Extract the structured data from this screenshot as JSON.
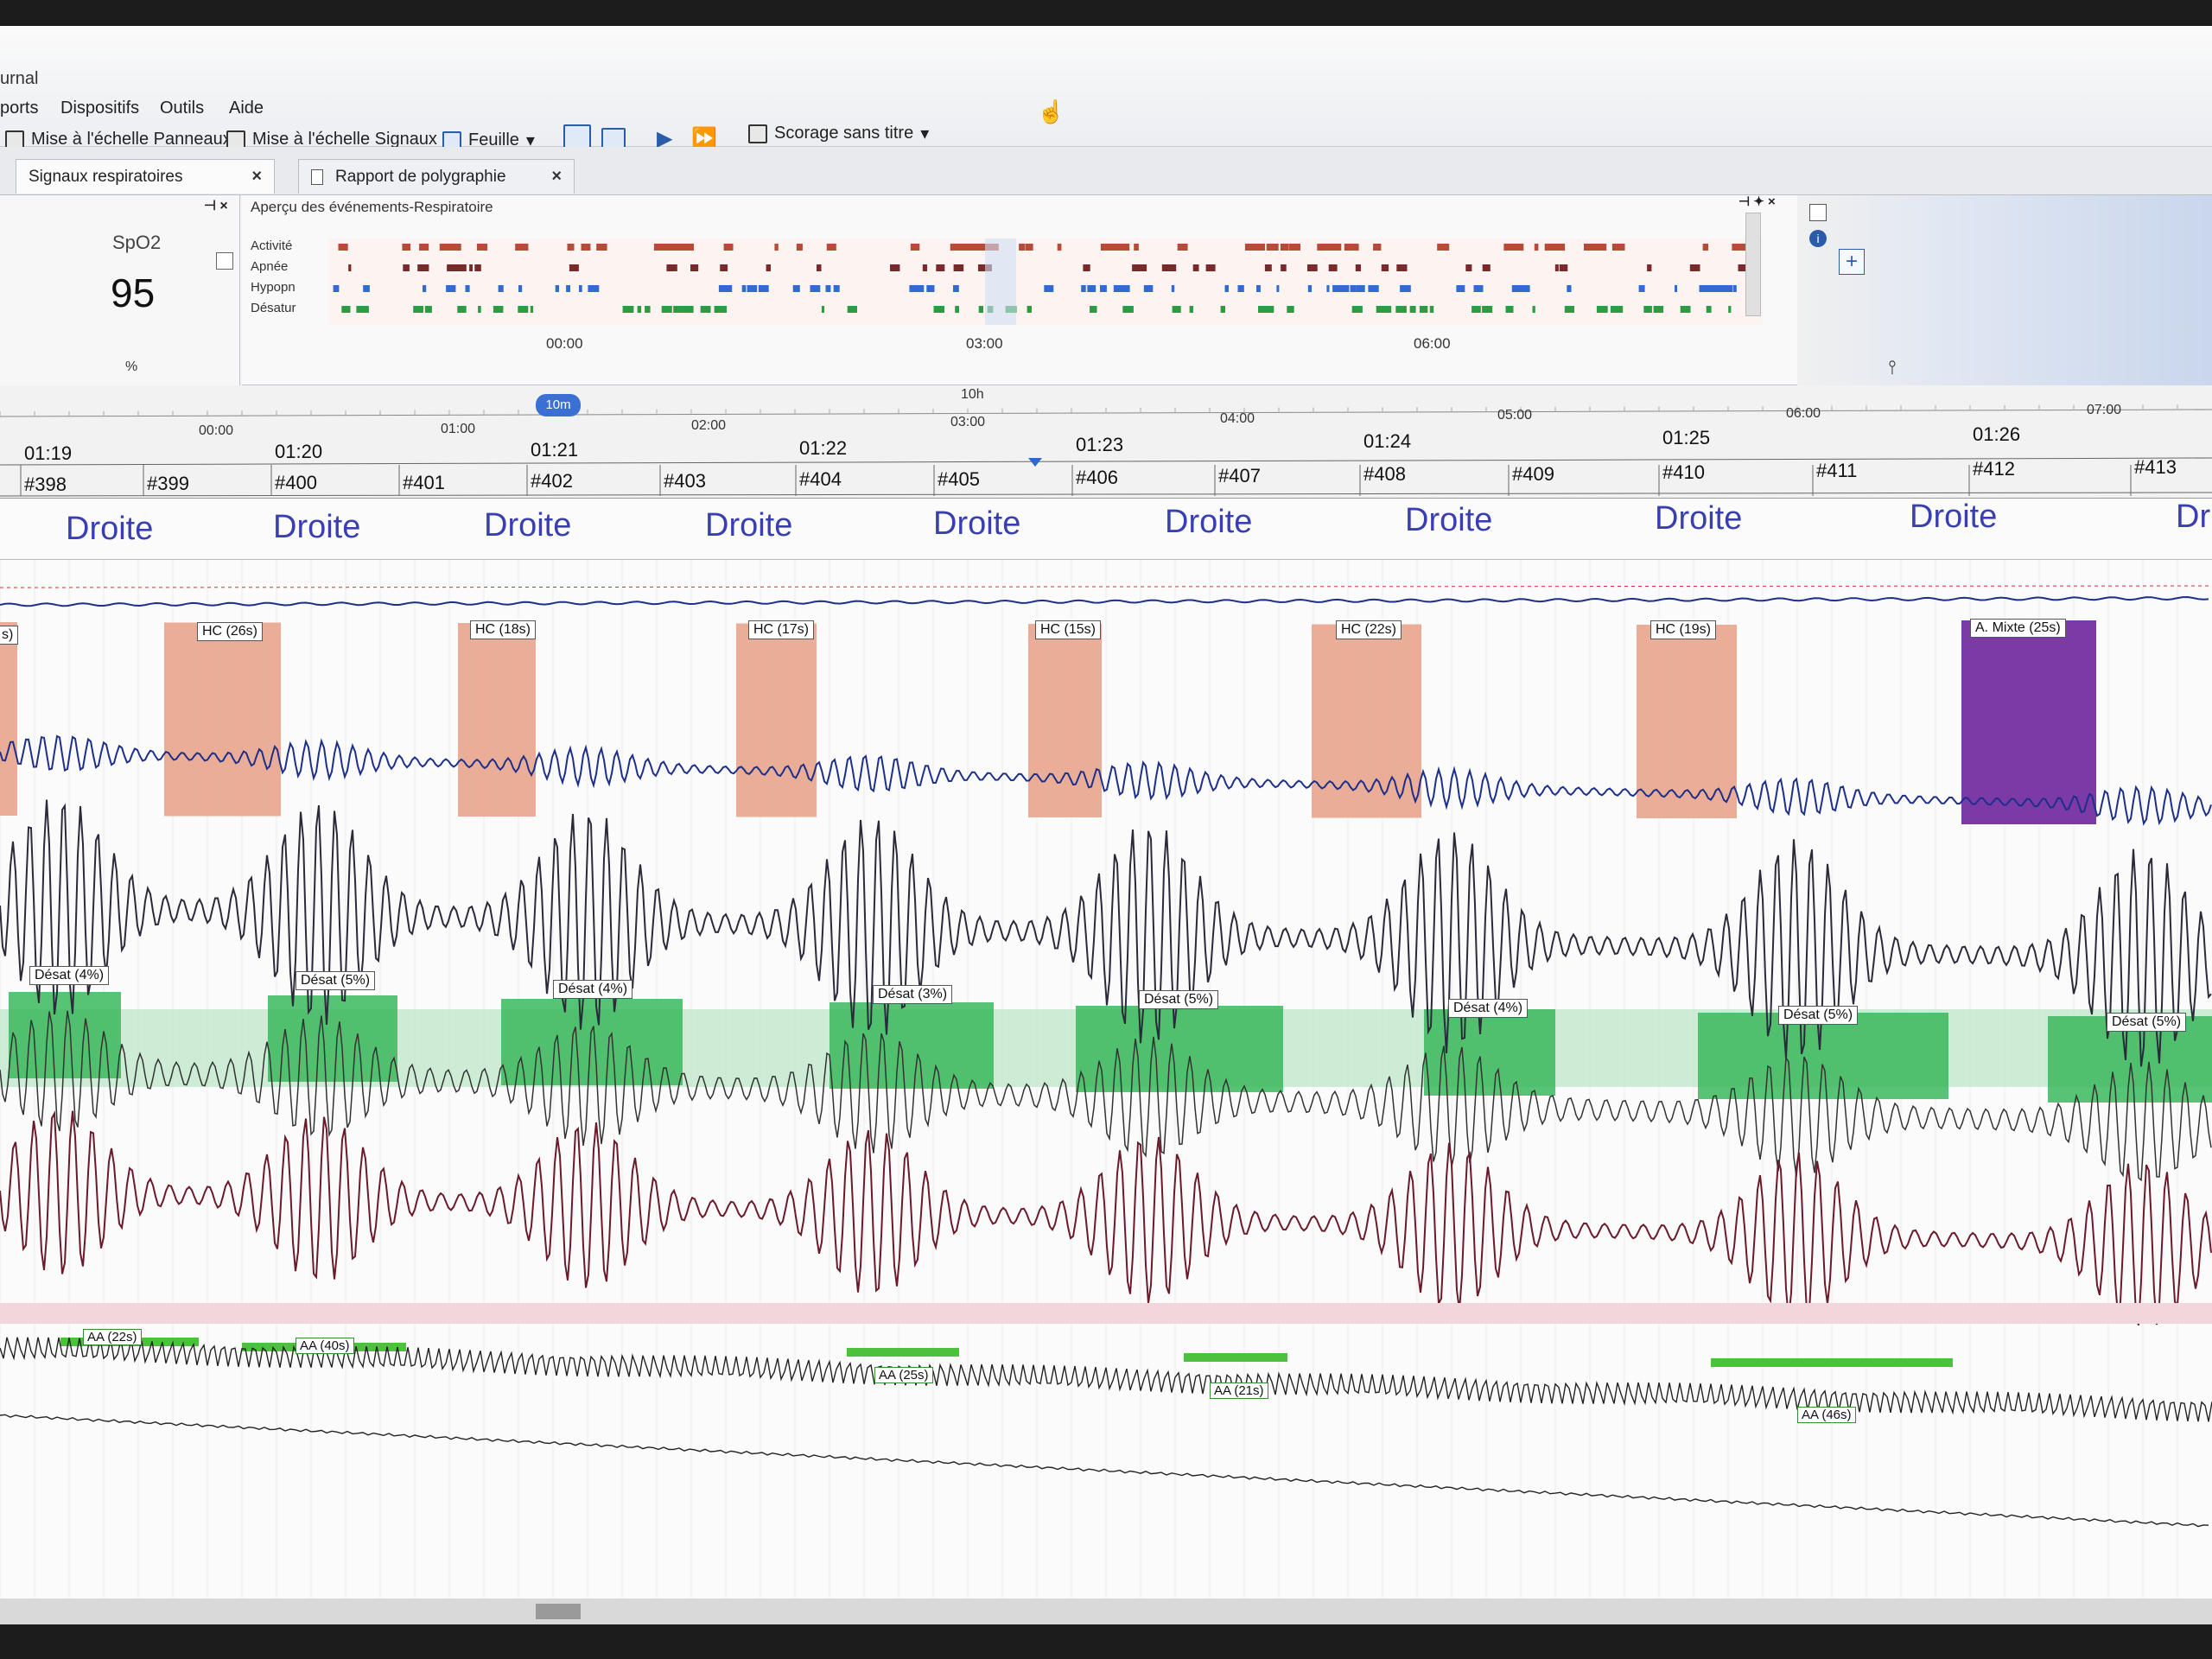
{
  "app": {
    "title_fragment": "urnal"
  },
  "menu": {
    "items": [
      "ports",
      "Dispositifs",
      "Outils",
      "Aide"
    ]
  },
  "toolbar": {
    "scale_panels": "Mise à l'échelle Panneaux",
    "scale_signals": "Mise à l'échelle Signaux",
    "sheet": "Feuille",
    "scoring": "Scorage sans titre"
  },
  "tabs": [
    {
      "label": "Signaux respiratoires"
    },
    {
      "label": "Rapport de polygraphie"
    }
  ],
  "spo2": {
    "label": "SpO2",
    "value": "95",
    "unit": "%"
  },
  "overview": {
    "title": "Aperçu des événements-Respiratoire",
    "rows": [
      "Activité",
      "Apnée",
      "Hypopn",
      "Désatur"
    ],
    "times": [
      "00:00",
      "03:00",
      "06:00"
    ]
  },
  "ruler": {
    "window": "10m",
    "marker": "10h",
    "hours": [
      "00:00",
      "01:00",
      "02:00",
      "03:00",
      "04:00",
      "05:00",
      "06:00",
      "07:00"
    ]
  },
  "epochs": {
    "times": [
      "01:19",
      "01:20",
      "01:21",
      "01:22",
      "01:23",
      "01:24",
      "01:25",
      "01:26"
    ],
    "numbers": [
      "#398",
      "#399",
      "#400",
      "#401",
      "#402",
      "#403",
      "#404",
      "#405",
      "#406",
      "#407",
      "#408",
      "#409",
      "#410",
      "#411",
      "#412",
      "#413"
    ]
  },
  "position": {
    "label": "Droite",
    "partial": "Dr"
  },
  "events": {
    "first_partial": "s)",
    "hc": [
      "HC (26s)",
      "HC (18s)",
      "HC (17s)",
      "HC (15s)",
      "HC (22s)",
      "HC (19s)"
    ],
    "mixed": "A. Mixte (25s)",
    "desat": [
      "Désat (4%)",
      "Désat (5%)",
      "Désat (4%)",
      "Désat (3%)",
      "Désat (5%)",
      "Désat (4%)",
      "Désat (5%)",
      "Désat (5%)"
    ],
    "aa": [
      "AA (22s)",
      "AA (40s)",
      "AA (25s)",
      "AA (21s)",
      "AA (46s)"
    ]
  },
  "colors": {
    "hypopnea": "#e8a48c",
    "mixed_apnea": "#7b3aa6",
    "desaturation": "#39b95c",
    "arousal": "#4cc23c",
    "position_text": "#3a3fb0",
    "flow_trace": "#1d2f8a",
    "effort_trace": "#2a2a3a",
    "thorax_trace": "#6a1a2a"
  }
}
